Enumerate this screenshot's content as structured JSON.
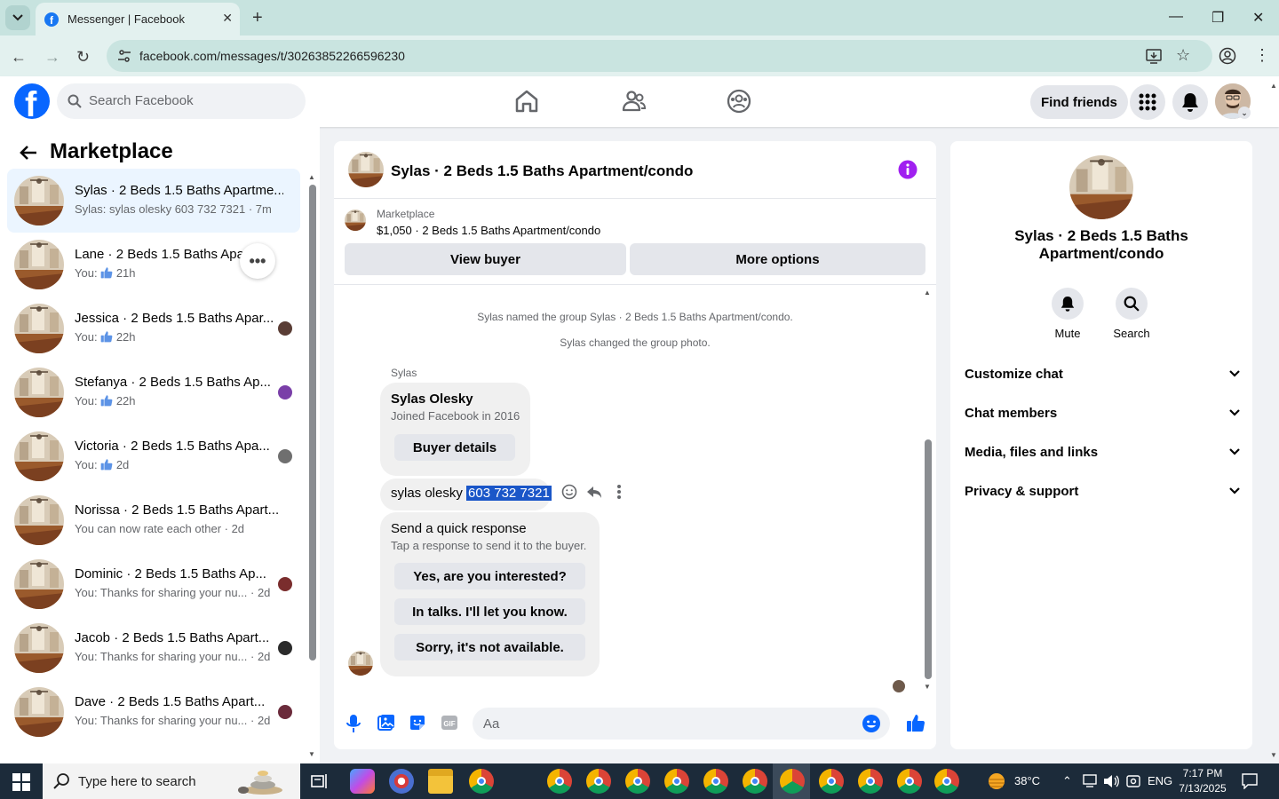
{
  "browser": {
    "tab_title": "Messenger | Facebook",
    "url": "facebook.com/messages/t/30263852266596230"
  },
  "fb_header": {
    "search_placeholder": "Search Facebook",
    "find_friends": "Find friends",
    "brand_color": "#0866ff"
  },
  "sidebar": {
    "title": "Marketplace",
    "conversations": [
      {
        "name": "Sylas · 2 Beds 1.5 Baths Apartme...",
        "preview": "Sylas: sylas olesky 603 732 7321 · 7m",
        "active": true
      },
      {
        "name": "Lane · 2 Beds 1.5 Baths Apart...",
        "preview_you": "You:",
        "preview_time": "21h"
      },
      {
        "name": "Jessica · 2 Beds 1.5 Baths Apar...",
        "preview_you": "You:",
        "preview_time": "22h"
      },
      {
        "name": "Stefanya · 2 Beds 1.5 Baths Ap...",
        "preview_you": "You:",
        "preview_time": "22h"
      },
      {
        "name": "Victoria · 2 Beds 1.5 Baths Apa...",
        "preview_you": "You:",
        "preview_time": "2d"
      },
      {
        "name": "Norissa · 2 Beds 1.5 Baths Apart...",
        "preview": "You can now rate each other · 2d"
      },
      {
        "name": "Dominic · 2 Beds 1.5 Baths Ap...",
        "preview": "You: Thanks for sharing your nu... · 2d"
      },
      {
        "name": "Jacob · 2 Beds 1.5 Baths Apart...",
        "preview": "You: Thanks for sharing your nu... · 2d"
      },
      {
        "name": "Dave · 2 Beds 1.5 Baths Apart...",
        "preview": "You: Thanks for sharing your nu... · 2d"
      }
    ]
  },
  "chat": {
    "title": "Sylas · 2 Beds 1.5 Baths Apartment/condo",
    "listing_source": "Marketplace",
    "listing_title": "$1,050 · 2 Beds 1.5 Baths Apartment/condo",
    "view_buyer": "View buyer",
    "more_options": "More options",
    "system_1": "Sylas named the group Sylas · 2 Beds 1.5 Baths Apartment/condo.",
    "system_2": "Sylas changed the group photo.",
    "sender": "Sylas",
    "card_name": "Sylas Olesky",
    "card_joined": "Joined Facebook in 2016",
    "buyer_details": "Buyer details",
    "message_plain": "sylas olesky ",
    "message_selected": "603 732 7321",
    "quick_title": "Send a quick response",
    "quick_sub": "Tap a response to send it to the buyer.",
    "quick_1": "Yes, are you interested?",
    "quick_2": "In talks. I'll let you know.",
    "quick_3": "Sorry, it's not available.",
    "composer_placeholder": "Aa"
  },
  "right_panel": {
    "name": "Sylas · 2 Beds 1.5 Baths Apartment/condo",
    "mute": "Mute",
    "search": "Search",
    "items": [
      "Customize chat",
      "Chat members",
      "Media, files and links",
      "Privacy & support"
    ]
  },
  "taskbar": {
    "search_placeholder": "Type here to search",
    "weather": "38°C",
    "lang": "ENG",
    "time": "7:17 PM",
    "date": "7/13/2025"
  }
}
